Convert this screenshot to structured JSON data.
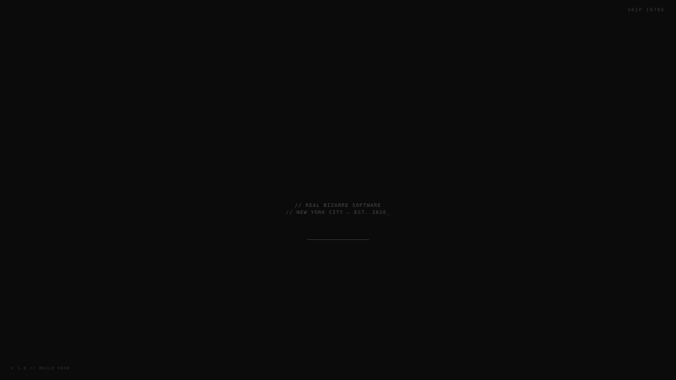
{
  "header": {
    "skip_label": "SKIP INTRO"
  },
  "intro": {
    "line1": "// REAL BIZARRE SOFTWARE",
    "line2": "// NEW YORK CITY — EST. 2026",
    "cursor": "_"
  },
  "loader": {
    "progress": 1.0
  },
  "footer": {
    "version": "V 1.0 // BUILD 0000"
  },
  "colors": {
    "background": "#0b0b0b",
    "text": "#4b4b4b"
  }
}
